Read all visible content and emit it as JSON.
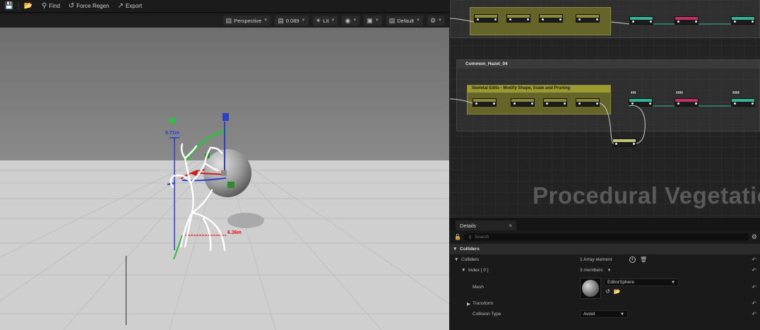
{
  "toolbar": {
    "find_label": "Find",
    "regen_label": "Force Regen",
    "export_label": "Export"
  },
  "viewport": {
    "perspective_label": "Perspective",
    "speed_value": "0.089",
    "lit_label": "Lit",
    "default_label": "Default",
    "dim_height": "9.71m",
    "dim_width": "6.36m"
  },
  "graph": {
    "comment_label": "Common_Hazel_04",
    "group_label": "Skeletal Edits - Modify Shape, Scale and Pruning",
    "watermark": "Procedural Vegetation"
  },
  "details": {
    "tab_label": "Details",
    "search_placeholder": "Search",
    "category": "Colliders",
    "colliders_label": "Colliders",
    "colliders_value": "1 Array element",
    "index_label": "Index [ 0 ]",
    "index_value": "3 members",
    "mesh_label": "Mesh",
    "mesh_value": "EditorSphere",
    "transform_label": "Transform",
    "collision_label": "Collision Type",
    "collision_value": "Avoid"
  },
  "colors": {
    "accent_green": "#37b39a",
    "accent_pink": "#c0306a",
    "comment_yellow": "#9a9a30",
    "axis_red": "#d02020",
    "axis_blue": "#2a3fd0",
    "axis_green": "#2fbf3a"
  }
}
